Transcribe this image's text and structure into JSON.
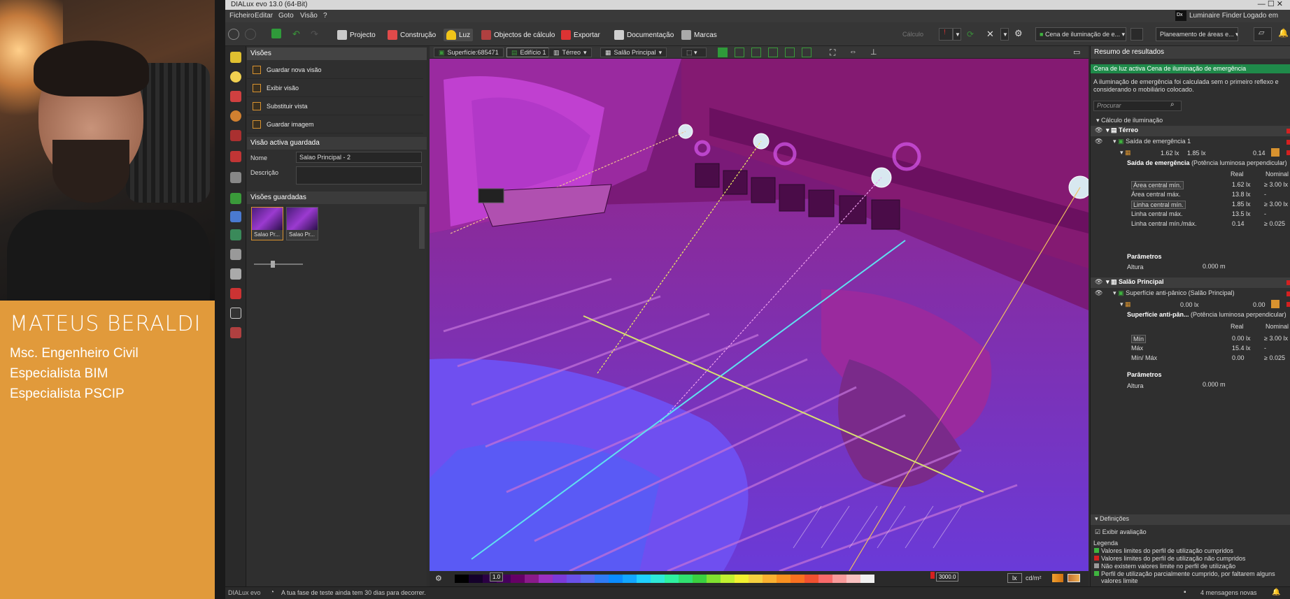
{
  "overlay": {
    "name": "MATEUS BERALDI",
    "lines": [
      "Msc. Engenheiro Civil",
      "Especialista BIM",
      "Especialista PSCIP"
    ]
  },
  "app": {
    "title": "DIALux evo 13.0  (64-Bit)",
    "menu": [
      "Ficheiro",
      "Editar",
      "Goto",
      "Visão",
      "?"
    ],
    "luminaire_finder": "Luminaire Finder",
    "logged_in": "Logado em"
  },
  "toolbar": {
    "items": [
      {
        "label": "Projecto",
        "color": "#c9c9c9"
      },
      {
        "label": "Construção",
        "color": "#e04a4a"
      },
      {
        "label": "Luz",
        "color": "#f0c419"
      },
      {
        "label": "Objectos de cálculo",
        "color": "#b04040"
      },
      {
        "label": "Exportar",
        "color": "#d33"
      },
      {
        "label": "Documentação",
        "color": "#cfcfcf"
      },
      {
        "label": "Marcas",
        "color": "#aaa"
      }
    ],
    "active": "Luz",
    "calc_label": "Cálculo",
    "scene_combo": "Cena de iluminação de e...",
    "planning_combo": "Planeamento de áreas e..."
  },
  "views_panel": {
    "title": "Visões",
    "actions": [
      "Guardar nova visão",
      "Exibir visão",
      "Substituir vista",
      "Guardar imagem"
    ],
    "active_header": "Visão activa guardada",
    "name_label": "Nome",
    "name_value": "Salao Principal - 2",
    "desc_label": "Descrição",
    "saved_header": "Visões guardadas",
    "thumbs": [
      "Salao Pr...",
      "Salao Pr..."
    ]
  },
  "viewport_bar": {
    "surface": "Superfície:685471",
    "building": "Edifício 1",
    "floor": "Térreo",
    "room": "Salão Principal"
  },
  "scale": {
    "min": "1.0",
    "max": "3000.0",
    "unit": "lx",
    "unit2": "cd/m²",
    "colors": [
      "#000000",
      "#14002a",
      "#2b0044",
      "#45005c",
      "#660066",
      "#8a1a8a",
      "#9b30c0",
      "#7b3ad8",
      "#6a50e8",
      "#5a6af0",
      "#2f7bf5",
      "#0a8cff",
      "#12a6ff",
      "#1fd0ff",
      "#2ee8d8",
      "#2ef0a0",
      "#30e070",
      "#3ad040",
      "#80e030",
      "#c0f030",
      "#f0f030",
      "#f5d040",
      "#f8b030",
      "#f89020",
      "#f87020",
      "#f05030",
      "#f86a6a",
      "#f89a9a",
      "#f8c0c0",
      "#f0f0f0"
    ]
  },
  "results": {
    "title": "Resumo de resultados",
    "scene_banner": "Cena de luz activa Cena de iluminação de emergência",
    "note": "A iluminação de emergência foi calculada sem o primeiro reflexo e considerando o mobiliário colocado.",
    "search_placeholder": "Procurar",
    "calc_header": "Cálculo de iluminação",
    "floor": "Térreo",
    "exit1": "Saída de emergência 1",
    "exit1_vals": [
      "1.62 lx",
      "1.85 lx",
      "0.14"
    ],
    "exit1_detail_title": "Saída de emergência",
    "exit1_detail_sub": "(Potência luminosa perpendicular)",
    "col_real": "Real",
    "col_nominal": "Nominal",
    "exit1_rows": [
      {
        "label": "Área central mín.",
        "real": "1.62 lx",
        "nominal": "≥ 3.00 lx"
      },
      {
        "label": "Área central máx.",
        "real": "13.8 lx",
        "nominal": "-"
      },
      {
        "label": "Linha central mín.",
        "real": "1.85 lx",
        "nominal": "≥ 3.00 lx"
      },
      {
        "label": "Linha central máx.",
        "real": "13.5 lx",
        "nominal": "-"
      },
      {
        "label": "Linha central mín./máx.",
        "real": "0.14",
        "nominal": "≥ 0.025"
      }
    ],
    "params_label": "Parâmetros",
    "height_label": "Altura",
    "height_value": "0.000 m",
    "room": "Salão Principal",
    "antipanic": "Superfície anti-pânico (Salão Principal)",
    "antipanic_vals": [
      "0.00 lx",
      "0.00"
    ],
    "antipanic_detail_title": "Superfície anti-pân...",
    "antipanic_detail_sub": "(Potência luminosa perpendicular)",
    "antipanic_rows": [
      {
        "label": "Mín",
        "real": "0.00 lx",
        "nominal": "≥ 3.00 lx"
      },
      {
        "label": "Máx",
        "real": "15.4 lx",
        "nominal": "-"
      },
      {
        "label": "Mín/ Máx",
        "real": "0.00",
        "nominal": "≥ 0.025"
      }
    ],
    "settings_header": "Definições",
    "show_eval": "Exibir avaliação",
    "legend_title": "Legenda",
    "legend": [
      {
        "color": "#3fb43f",
        "text": "Valores limites do perfil de utilização cumpridos"
      },
      {
        "color": "#d42020",
        "text": "Valores limites do perfil de utilização não cumpridos"
      },
      {
        "color": "#9a9a9a",
        "text": "Não existem valores limite no perfil de utilização"
      },
      {
        "color": "#3fb43f",
        "text": "Perfil de utilização parcialmente cumprido, por faltarem alguns valores limite"
      }
    ]
  },
  "status": {
    "brand": "DIALux evo",
    "message": "A tua fase de teste ainda tem 30 dias para decorrer.",
    "messages": "4 mensagens novas"
  }
}
